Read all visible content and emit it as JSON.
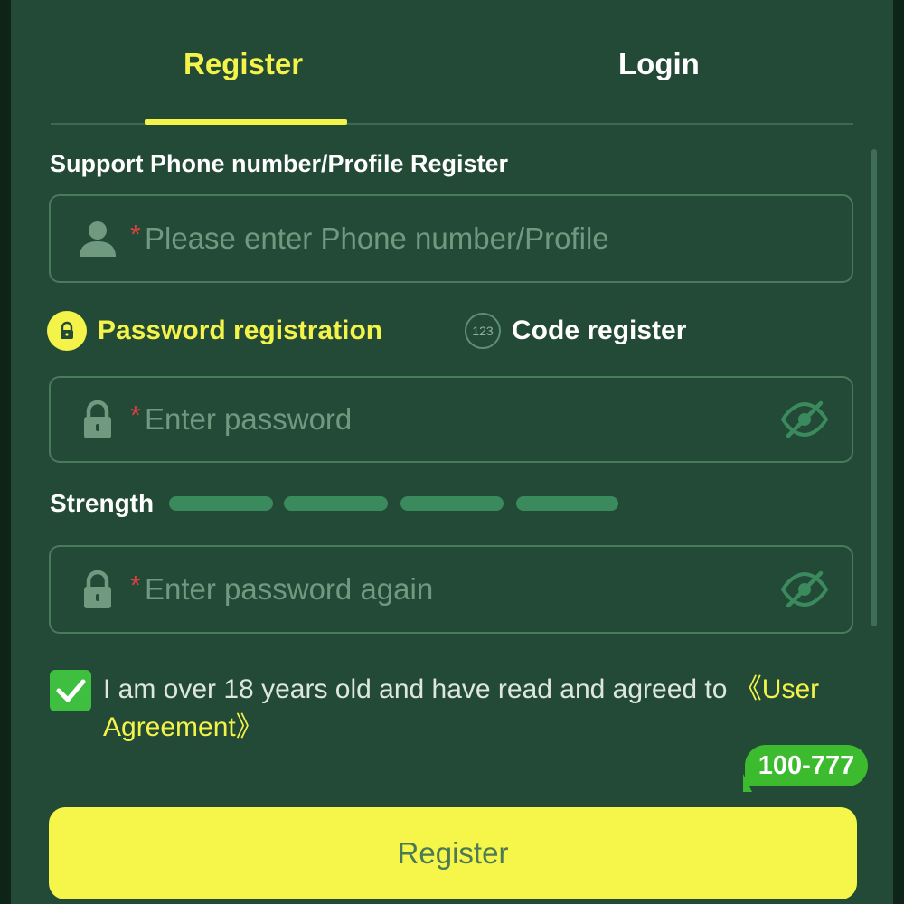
{
  "tabs": {
    "register": "Register",
    "login": "Login"
  },
  "form": {
    "section_label": "Support Phone number/Profile Register",
    "phone_placeholder": "Please enter Phone number/Profile",
    "required_mark": "*",
    "methods": {
      "password": "Password registration",
      "code": "Code register",
      "code_icon_text": "123"
    },
    "password_placeholder": "Enter password",
    "password_again_placeholder": "Enter password again",
    "strength_label": "Strength",
    "strength_segments": 4,
    "agreement": {
      "text": "I am over 18 years old and have read and agreed to ",
      "link": "《User Agreement》",
      "checked": true
    },
    "submit_label": "Register"
  },
  "badge": {
    "text": "100-777"
  },
  "icons": {
    "phone_field": "user-icon",
    "password_field": "lock-icon",
    "visibility": "eye-off-icon",
    "password_method": "lock-icon",
    "code_method": "numeric-code-icon",
    "checkbox": "check-icon"
  },
  "colors": {
    "panel": "#234a36",
    "accent_yellow": "#f3f34a",
    "checkbox_green": "#3fbf3f",
    "badge_green": "#3dbb2e",
    "strength_bar": "#3b8a5e",
    "input_border": "#4a7a5c"
  }
}
